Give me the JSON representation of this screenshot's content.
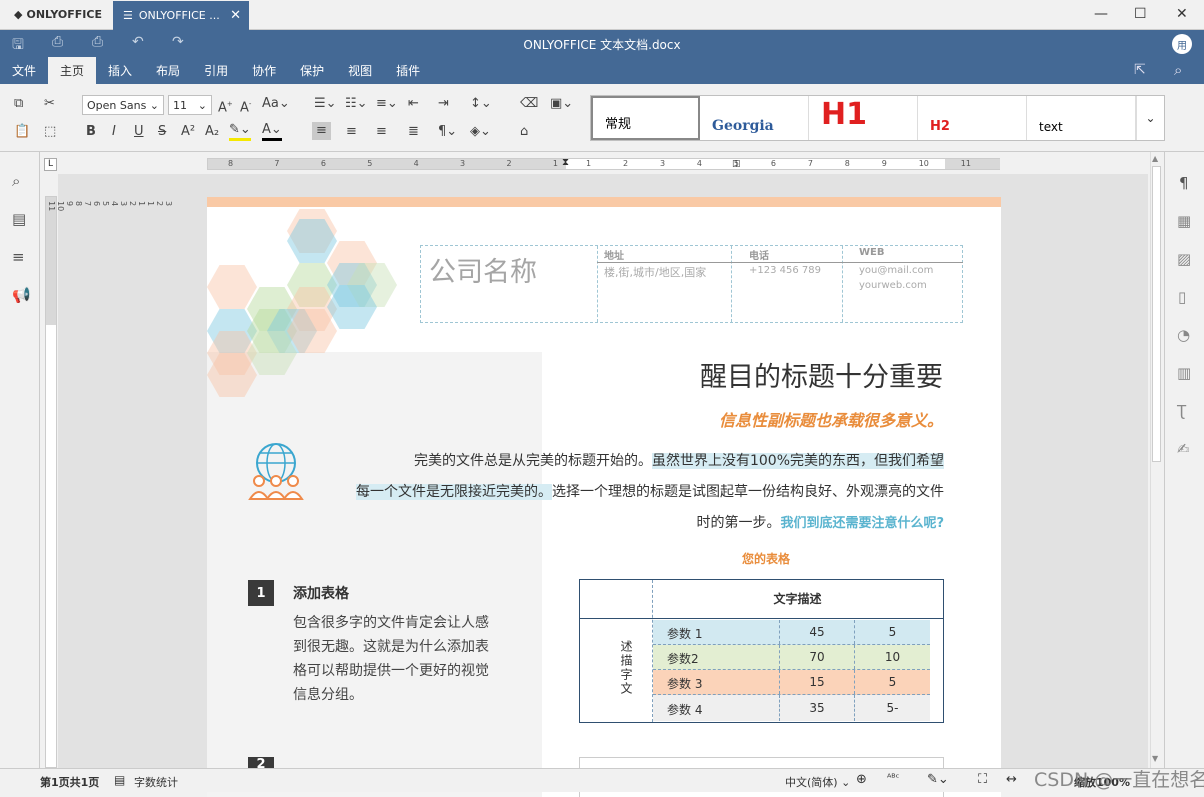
{
  "app": {
    "name": "ONLYOFFICE",
    "tab_label": "ONLYOFFICE ...",
    "doc_title": "ONLYOFFICE 文本文档.docx",
    "avatar": "用"
  },
  "menu": [
    "文件",
    "主页",
    "插入",
    "布局",
    "引用",
    "协作",
    "保护",
    "视图",
    "插件"
  ],
  "toolbar": {
    "font_name": "Open Sans",
    "font_size": "11",
    "styles": [
      "常规",
      "Georgia",
      "H1",
      "H2",
      "text"
    ]
  },
  "ruler": {
    "h_left": [
      "8",
      "7",
      "6",
      "5",
      "4",
      "3",
      "2",
      "1"
    ],
    "h_right": [
      "1",
      "2",
      "3",
      "4",
      "5",
      "6",
      "7",
      "8",
      "9",
      "10",
      "11"
    ],
    "v": [
      "3",
      "2",
      "1",
      "1",
      "2",
      "3",
      "4",
      "5",
      "6",
      "7",
      "8",
      "9",
      "10",
      "11"
    ]
  },
  "doc": {
    "company": "公司名称",
    "contacts": [
      {
        "label": "地址",
        "value": "楼,街,城市/地区,国家"
      },
      {
        "label": "电话",
        "value": "+123 456 789"
      },
      {
        "label": "WEB",
        "value": "you@mail.com",
        "value2": "yourweb.com"
      }
    ],
    "title": "醒目的标题十分重要",
    "subtitle": "信息性副标题也承载很多意义。",
    "intro_line1": "完美的文件总是从完美的标题开始的。",
    "intro_hl1": "虽然世界上没有100%完美的东西，但我们希望",
    "intro_hl2": "每一个文件是无限接近完美的。",
    "intro_line2": "选择一个理想的标题是试图起草一份结构良好、外观漂亮的文件",
    "intro_line3": "时的第一步。",
    "intro_link": "我们到底还需要注意什么呢?",
    "section_num": "1",
    "section_title": "添加表格",
    "section_body": [
      "包含很多字的文件肯定会让人感",
      "到很无趣。这就是为什么添加表",
      "格可以帮助提供一个更好的视觉",
      "信息分组。"
    ],
    "section2_num": "2",
    "table_caption": "您的表格",
    "table_header": "文字描述",
    "table_side": "述描字文",
    "table_rows": [
      {
        "label": "参数 1",
        "a": "45",
        "b": "5",
        "color": "#d2e9f1"
      },
      {
        "label": "参数2",
        "a": "70",
        "b": "10",
        "color": "#e3eed2"
      },
      {
        "label": "参数 3",
        "a": "15",
        "b": "5",
        "color": "#fbd3b9"
      },
      {
        "label": "参数 4",
        "a": "35",
        "b": "5-",
        "color": "#efefef"
      }
    ]
  },
  "status": {
    "page": "第1页共1页",
    "word_count": "字数统计",
    "language": "中文(简体)",
    "zoom": "缩放100%",
    "watermark": "CSDN @一直在想名"
  },
  "colors": {
    "brand": "#446995",
    "accent_orange": "#e98d3c",
    "accent_teal": "#5ab4cf"
  }
}
